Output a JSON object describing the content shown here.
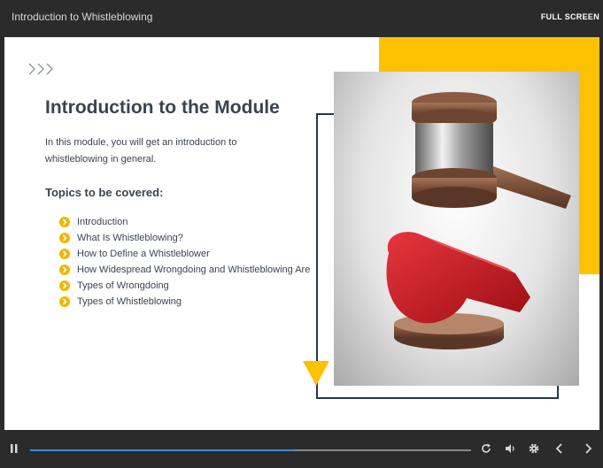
{
  "header": {
    "title": "Introduction to Whistleblowing",
    "fullscreen_label": "FULL SCREEN"
  },
  "slide": {
    "heading": "Introduction to the Module",
    "intro": "In this module, you will get an introduction to whistleblowing in general.",
    "topics_title": "Topics to be covered:",
    "topics": [
      "Introduction",
      "What Is Whistleblowing?",
      "How to Define a Whistleblower",
      "How Widespread Wrongdoing and Whistleblowing Are",
      "Types of Wrongdoing",
      "Types of Whistleblowing"
    ]
  },
  "player": {
    "progress_fraction": 0.6,
    "icons": [
      "pause-icon",
      "replay-icon",
      "volume-icon",
      "settings-icon",
      "prev-icon",
      "next-icon"
    ]
  },
  "colors": {
    "accent": "#fcc100",
    "frame": "#1f3a4d",
    "progress": "#3d8fd6",
    "text": "#3c4350"
  }
}
